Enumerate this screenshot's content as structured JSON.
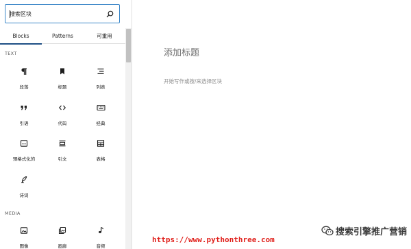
{
  "inserter": {
    "search": {
      "placeholder": "搜索区块",
      "value": ""
    },
    "tabs": [
      {
        "label": "Blocks",
        "active": true
      },
      {
        "label": "Patterns",
        "active": false
      },
      {
        "label": "可重用",
        "active": false
      }
    ],
    "categories": [
      {
        "heading": "TEXT",
        "blocks": [
          {
            "label": "段落",
            "icon": "paragraph-icon"
          },
          {
            "label": "标题",
            "icon": "heading-bookmark-icon"
          },
          {
            "label": "列表",
            "icon": "list-icon"
          },
          {
            "label": "引语",
            "icon": "quote-icon"
          },
          {
            "label": "代码",
            "icon": "code-icon"
          },
          {
            "label": "经典",
            "icon": "keyboard-icon"
          },
          {
            "label": "预格式化的",
            "icon": "preformatted-icon"
          },
          {
            "label": "引文",
            "icon": "pullquote-icon"
          },
          {
            "label": "表格",
            "icon": "table-icon"
          },
          {
            "label": "诗词",
            "icon": "feather-icon"
          }
        ]
      },
      {
        "heading": "MEDIA",
        "blocks": [
          {
            "label": "图像",
            "icon": "image-icon"
          },
          {
            "label": "画廊",
            "icon": "gallery-icon"
          },
          {
            "label": "音频",
            "icon": "audio-icon"
          }
        ]
      }
    ]
  },
  "editor": {
    "title_placeholder": "添加标题",
    "body_placeholder": "开始写作或按/来选择区块"
  },
  "watermarks": {
    "url": "https://www.pythonthree.com",
    "wechat": "搜索引擎推广营销"
  },
  "colors": {
    "search_border": "#3a86c8",
    "tab_indicator": "#1e4f85",
    "url_watermark": "#e0211c"
  }
}
